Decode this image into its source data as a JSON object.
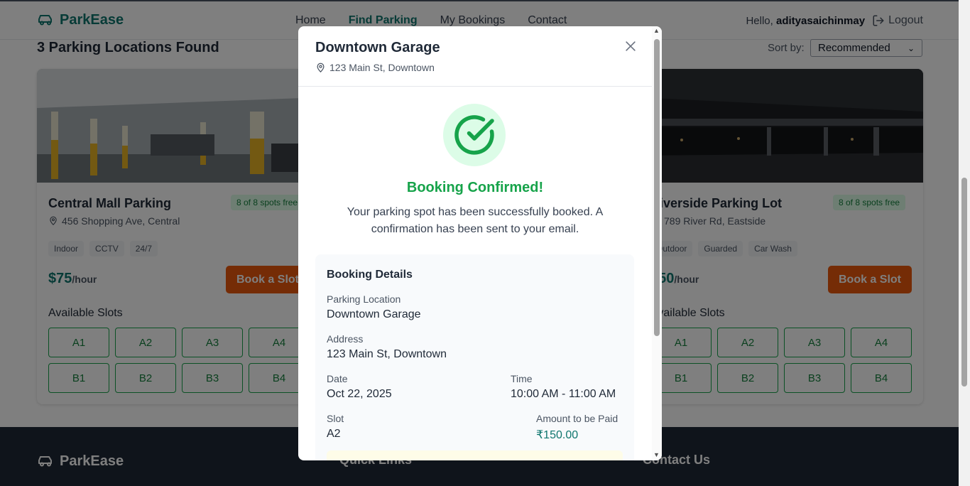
{
  "header": {
    "brand": "ParkEase",
    "nav": [
      "Home",
      "Find Parking",
      "My Bookings",
      "Contact"
    ],
    "greeting_prefix": "Hello,",
    "username": "adityasaichinmay",
    "logout": "Logout"
  },
  "results": {
    "title": "3 Parking Locations Found",
    "sort_label": "Sort by:",
    "sort_value": "Recommended"
  },
  "cards": [
    {
      "name": "Central Mall Parking",
      "address": "456 Shopping Ave, Central",
      "spots": "8 of 8 spots free",
      "tags": [
        "Indoor",
        "CCTV",
        "24/7"
      ],
      "price": "$75",
      "per": "/hour",
      "book": "Book a Slot",
      "available": "Available Slots",
      "slots": [
        "A1",
        "A2",
        "A3",
        "A4",
        "B1",
        "B2",
        "B3",
        "B4"
      ]
    },
    {
      "name": "Riverside Parking Lot",
      "address": "789 River Rd, Eastside",
      "spots": "8 of 8 spots free",
      "tags": [
        "Outdoor",
        "Guarded",
        "Car Wash"
      ],
      "price": "$50",
      "per": "/hour",
      "book": "Book a Slot",
      "available": "Available Slots",
      "slots": [
        "A1",
        "A2",
        "A3",
        "A4",
        "B1",
        "B2",
        "B3",
        "B4"
      ]
    }
  ],
  "footer": {
    "brand": "ParkEase",
    "quick_links": "Quick Links",
    "contact": "Contact Us"
  },
  "modal": {
    "title": "Downtown Garage",
    "address": "123 Main St, Downtown",
    "confirmed": "Booking Confirmed!",
    "message": "Your parking spot has been successfully booked. A confirmation has been sent to your email.",
    "details": {
      "heading": "Booking Details",
      "location_label": "Parking Location",
      "location": "Downtown Garage",
      "address_label": "Address",
      "address": "123 Main St, Downtown",
      "date_label": "Date",
      "date": "Oct 22, 2025",
      "time_label": "Time",
      "time": "10:00 AM - 11:00 AM",
      "slot_label": "Slot",
      "slot": "A2",
      "amount_label": "Amount to be Paid",
      "amount": "₹150.00"
    }
  },
  "colors": {
    "brand": "#0f766e",
    "accent_button": "#ea580c",
    "success": "#16a34a"
  }
}
